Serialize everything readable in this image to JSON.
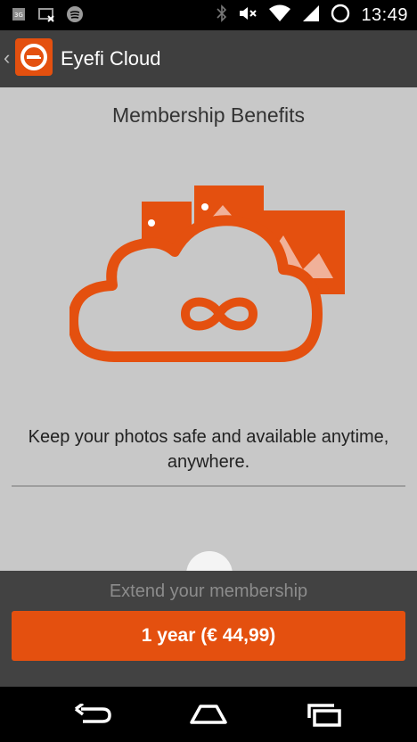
{
  "status_bar": {
    "time": "13:49",
    "icons": [
      "sim-icon",
      "image-muted-icon",
      "spotify-icon",
      "bluetooth-icon",
      "mute-icon",
      "wifi-icon",
      "signal-icon",
      "sync-icon"
    ]
  },
  "action_bar": {
    "title": "Eyefi Cloud",
    "back_icon": "chevron-left-icon",
    "logo_icon": "eyefi-logo-icon"
  },
  "main": {
    "heading": "Membership Benefits",
    "tagline": "Keep your photos safe and available anytime, anywhere.",
    "illustration": "cloud-infinity-photos-icon"
  },
  "bottom": {
    "extend_label": "Extend your membership",
    "purchase_label": "1 year (€ 44,99)"
  },
  "nav": {
    "back": "back-icon",
    "home": "home-icon",
    "recents": "recents-icon"
  },
  "colors": {
    "accent": "#e4500f",
    "action_bar": "#3f3f3f",
    "content_bg": "#c8c8c8",
    "bottom_bg": "#424242"
  }
}
